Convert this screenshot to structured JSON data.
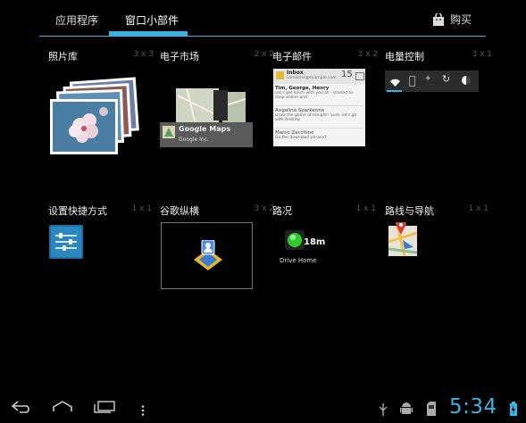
{
  "tabs": [
    {
      "label": "应用程序"
    },
    {
      "label": "窗口小部件"
    }
  ],
  "buy_label": "购买",
  "widgets": [
    {
      "name": "照片库",
      "size": "3 x 3"
    },
    {
      "name": "电子市场",
      "size": "2 x 2"
    },
    {
      "name": "电子邮件",
      "size": "3 x 2"
    },
    {
      "name": "电量控制",
      "size": "3 x 1"
    },
    {
      "name": "设置快捷方式",
      "size": "1 x 1"
    },
    {
      "name": "谷歌纵横",
      "size": "3 x 2"
    },
    {
      "name": "路况",
      "size": "1 x 1"
    },
    {
      "name": "路线与导航",
      "size": "1 x 1"
    }
  ],
  "market_preview": {
    "title": "Google Maps",
    "subtitle": "Google Inc."
  },
  "email_preview": {
    "inbox_label": "Inbox",
    "account": "someone@example.com",
    "count": "15",
    "messages": [
      {
        "sender": "Tim, George, Henry",
        "snippet": "Let's get lunch with you all - started to shop online and",
        "time": ""
      },
      {
        "sender": "Angelina Sparkenne",
        "snippet": "Draw the game of tonight? Sure, let's go with Andrew",
        "time": ""
      },
      {
        "sender": "Marco Zacchino",
        "snippet": "Do the download phrase?",
        "time": ""
      }
    ]
  },
  "traffic_preview": {
    "minutes": "18m",
    "label": "Drive Home"
  },
  "clock": "5:34",
  "colors": {
    "accent": "#33b5e5",
    "background": "#000000"
  }
}
